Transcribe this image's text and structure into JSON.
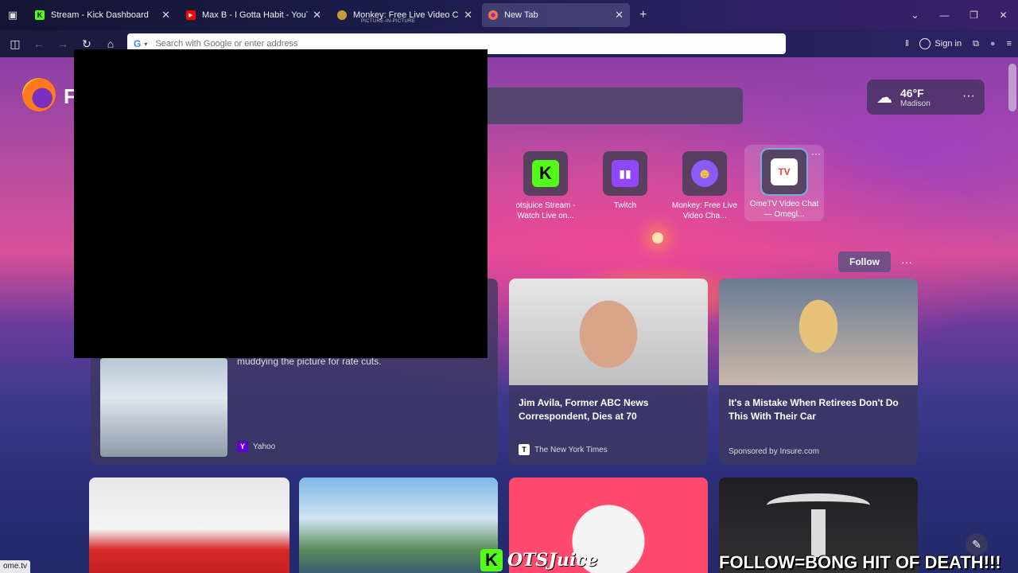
{
  "browser": {
    "tabs": [
      {
        "title": "Stream - Kick Dashboard",
        "favicon": "kick-icon",
        "color": "#53fc18"
      },
      {
        "title": "Max B - I Gotta Habit - YouTube",
        "favicon": "youtube-icon",
        "color": "#ff0000"
      },
      {
        "title": "Monkey: Free Live Video Chat t",
        "subtitle": "PICTURE-IN-PICTURE",
        "favicon": "monkey-icon",
        "color": "#f5c542"
      },
      {
        "title": "New Tab",
        "favicon": "firefox-icon",
        "color": "#ff7139",
        "active": true
      }
    ],
    "url_placeholder": "Search with Google or enter address",
    "signin_label": "Sign in"
  },
  "weather": {
    "temp": "46°F",
    "city": "Madison"
  },
  "shortcuts": [
    {
      "label": "otsjuice Stream - Watch Live on...",
      "icon": "kick-icon",
      "glyph": "K",
      "bg": "#53fc18",
      "fg": "#000000"
    },
    {
      "label": "Twitch",
      "icon": "twitch-icon",
      "glyph": "▮▮",
      "bg": "#9146ff",
      "fg": "#ffffff"
    },
    {
      "label": "Monkey: Free Live Video Cha...",
      "icon": "monkey-icon",
      "glyph": "🐵",
      "bg": "#8a5cf6",
      "fg": "#ffffff"
    },
    {
      "label": "OmeTV Video Chat — Omegl...",
      "icon": "ometv-icon",
      "glyph": "TV",
      "bg": "#ffffff",
      "fg": "#e8453c"
    }
  ],
  "feed": {
    "follow_label": "Follow",
    "cards": [
      {
        "headline": "muddying the picture for rate cuts.",
        "source": "Yahoo",
        "source_icon": "Y"
      },
      {
        "headline": "Jim Avila, Former ABC News Correspondent, Dies at 70",
        "source": "The New York Times",
        "source_icon": "𝕿"
      },
      {
        "headline": "It's a Mistake When Retirees Don't Do This With Their Car",
        "source": "Sponsored by Insure.com"
      }
    ]
  },
  "overlay": {
    "follow_text": "FOLLOW=BONG HIT OF DEATH!!!",
    "brand_text": "OTSJuice"
  },
  "status_url": "ome.tv"
}
